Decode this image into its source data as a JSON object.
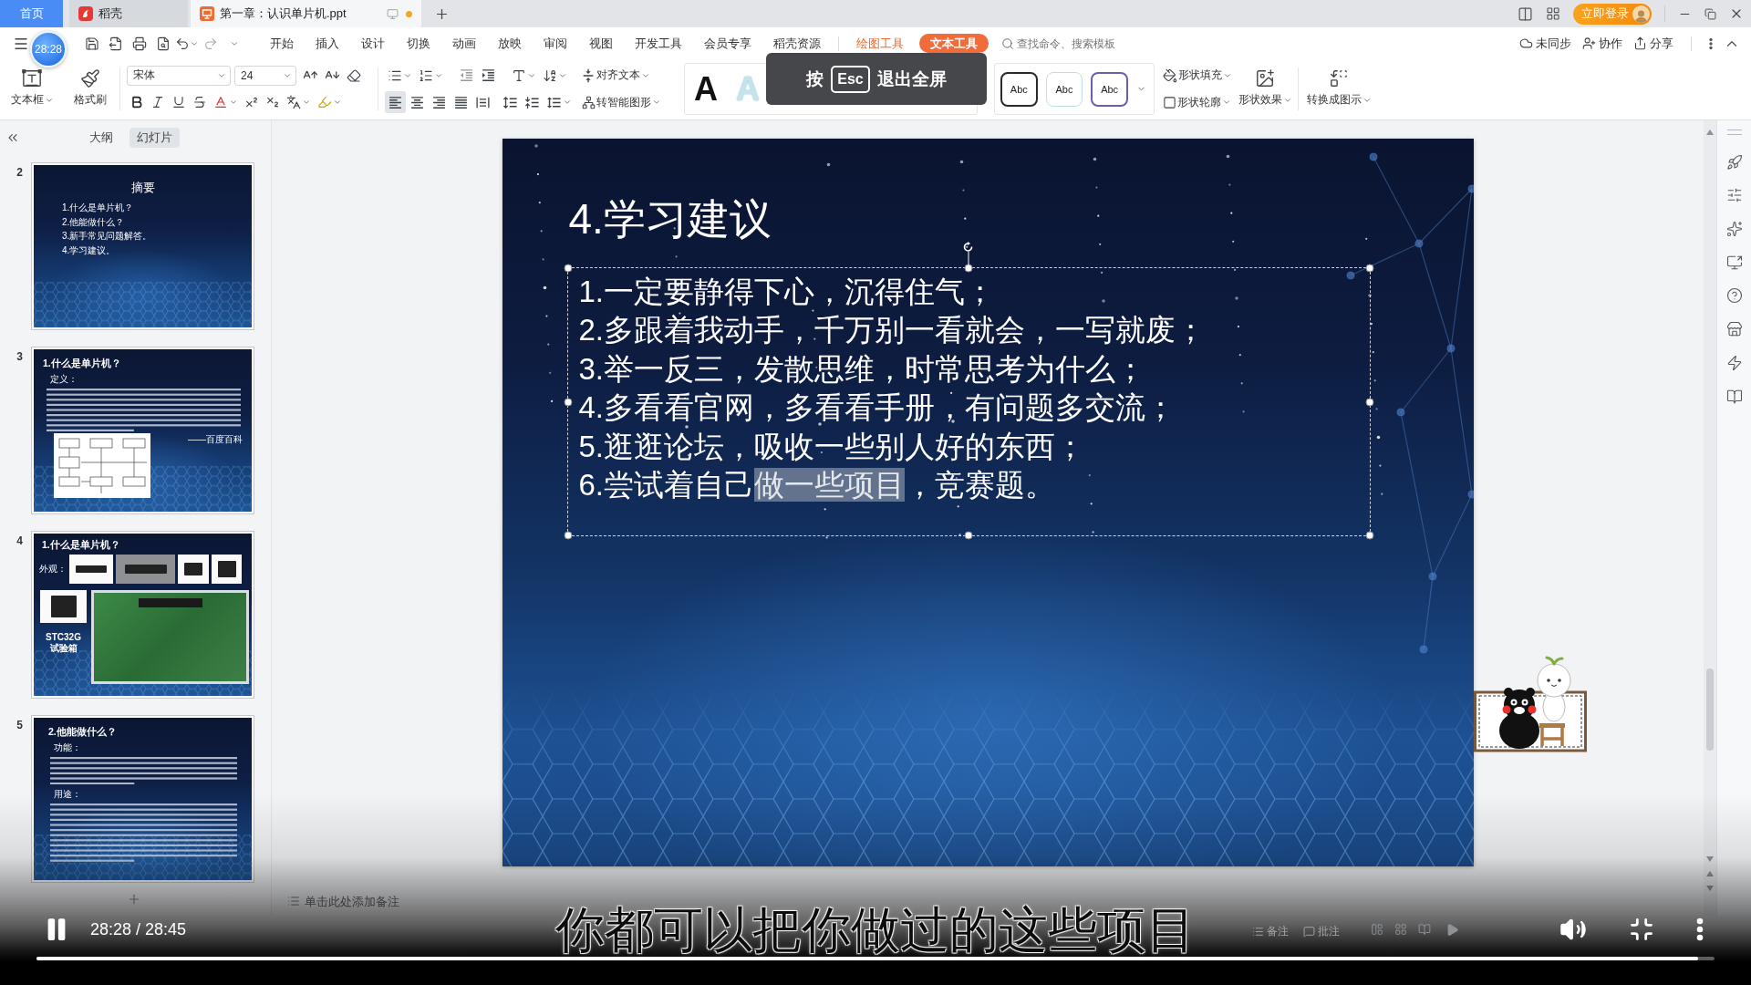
{
  "tab_bar": {
    "tabs": [
      {
        "label": "首页",
        "kind": "home",
        "selected": false
      },
      {
        "label": "稻壳",
        "kind": "app",
        "selected": false
      },
      {
        "label": "第一章：认识单片机.ppt",
        "kind": "document",
        "selected": true,
        "unsaved": true
      }
    ],
    "login": "立即登录"
  },
  "timer_badge": "28:28",
  "menu": {
    "tabs": [
      {
        "label": "开始",
        "kind": "main",
        "selected": false
      },
      {
        "label": "插入",
        "kind": "main",
        "selected": false
      },
      {
        "label": "设计",
        "kind": "main",
        "selected": false
      },
      {
        "label": "切换",
        "kind": "main",
        "selected": false
      },
      {
        "label": "动画",
        "kind": "main",
        "selected": false
      },
      {
        "label": "放映",
        "kind": "main",
        "selected": false
      },
      {
        "label": "审阅",
        "kind": "main",
        "selected": false
      },
      {
        "label": "视图",
        "kind": "main",
        "selected": false
      },
      {
        "label": "开发工具",
        "kind": "main",
        "selected": false
      },
      {
        "label": "会员专享",
        "kind": "main",
        "selected": false
      },
      {
        "label": "稻壳资源",
        "kind": "main",
        "selected": false
      },
      {
        "label": "绘图工具",
        "kind": "context",
        "selected": false
      },
      {
        "label": "文本工具",
        "kind": "context",
        "selected": true
      }
    ],
    "search": {
      "placeholder": "查找命令、搜索模板"
    },
    "actions": [
      {
        "label": "未同步",
        "kind": "sync"
      },
      {
        "label": "协作",
        "kind": "collaborate"
      },
      {
        "label": "分享",
        "kind": "share"
      }
    ]
  },
  "ribbon": {
    "text_box": "文本框",
    "format_painter": "格式刷",
    "font": {
      "family": "宋体",
      "size": "24"
    },
    "text_align": "对齐文本",
    "smart_graphic": "转智能图形",
    "alignments": [
      {
        "kind": "left",
        "selected": true
      },
      {
        "kind": "center",
        "selected": false
      },
      {
        "kind": "right",
        "selected": false
      },
      {
        "kind": "justify",
        "selected": false
      },
      {
        "kind": "distributed",
        "selected": false
      }
    ],
    "text_styles": [
      {
        "text": "A",
        "kind": "solid"
      },
      {
        "text": "A",
        "kind": "pale"
      }
    ],
    "shape_styles": [
      {
        "text": "Abc",
        "kind": "dark"
      },
      {
        "text": "Abc",
        "kind": "light"
      },
      {
        "text": "Abc",
        "kind": "violet"
      }
    ],
    "shape_fill": "形状填充",
    "shape_outline": "形状轮廓",
    "shape_effects": "形状效果",
    "convert": "转换成图示"
  },
  "esc_hint": {
    "before": "按",
    "key": "Esc",
    "after": "退出全屏"
  },
  "slides_panel": {
    "tabs": [
      {
        "label": "大纲",
        "selected": false
      },
      {
        "label": "幻灯片",
        "selected": true
      }
    ],
    "slides": [
      {
        "number": "2",
        "kind": "summary",
        "title": "摘要",
        "lines": [
          "1.什么是单片机？",
          "2.他能做什么？",
          "3.新手常见问题解答。",
          "4.学习建议。"
        ]
      },
      {
        "number": "3",
        "kind": "definition",
        "title": "1.什么是单片机？",
        "heading": "定义：",
        "source": "——百度百科"
      },
      {
        "number": "4",
        "kind": "photos",
        "title": "1.什么是单片机？",
        "heading": "外观：",
        "caption": [
          "STC32G",
          "试验箱"
        ]
      },
      {
        "number": "5",
        "kind": "uses",
        "title": "2.他能做什么？",
        "headings": [
          "功能：",
          "用途："
        ]
      }
    ]
  },
  "slide": {
    "title": "4.学习建议",
    "lines": [
      {
        "parts": [
          {
            "text": "1.一定要静得下心，沉得住气；",
            "selected": false
          }
        ]
      },
      {
        "parts": [
          {
            "text": "2.多跟着我动手，千万别一看就会，一写就废；",
            "selected": false
          }
        ]
      },
      {
        "parts": [
          {
            "text": "3.举一反三，发散思维，时常思考为什么；",
            "selected": false
          }
        ]
      },
      {
        "parts": [
          {
            "text": "4.多看看官网，多看看手册，有问题多交流；",
            "selected": false
          }
        ]
      },
      {
        "parts": [
          {
            "text": "5.逛逛论坛，吸收一些别人好的东西；",
            "selected": false
          }
        ]
      },
      {
        "parts": [
          {
            "text": "6.尝试着自己",
            "selected": false
          },
          {
            "text": "做一些项目",
            "selected": true
          },
          {
            "text": "，竞赛题。",
            "selected": false
          }
        ]
      }
    ]
  },
  "notes": {
    "placeholder": "单击此处添加备注"
  },
  "status_bar": {
    "items": [
      {
        "label": "备注",
        "kind": "notes"
      },
      {
        "label": "批注",
        "kind": "comments"
      }
    ]
  },
  "player": {
    "playing": true,
    "time": "28:28 / 28:45",
    "subtitle": "你都可以把你做过的这些项目",
    "level": 0.99
  }
}
